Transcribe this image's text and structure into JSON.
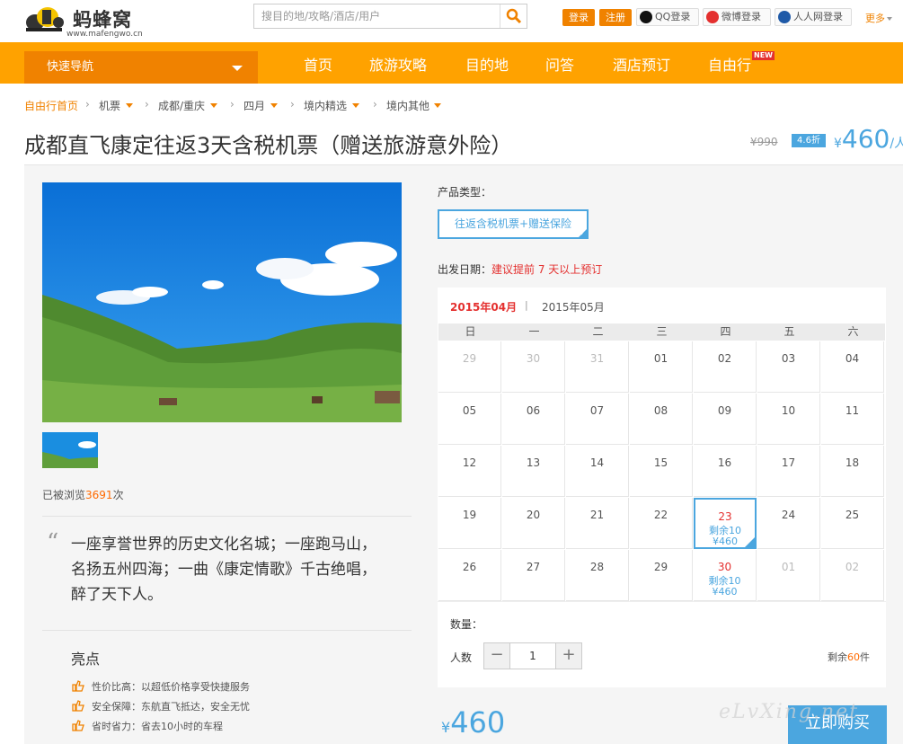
{
  "header": {
    "logo_text": "蚂蜂窝",
    "logo_url": "www.mafengwo.cn",
    "search_placeholder": "搜目的地/攻略/酒店/用户",
    "login": "登录",
    "register": "注册",
    "qq_login": "QQ登录",
    "weibo_login": "微博登录",
    "renren_login": "人人网登录",
    "more": "更多"
  },
  "nav": {
    "quick_nav": "快速导航",
    "items": [
      "首页",
      "旅游攻略",
      "目的地",
      "问答",
      "酒店预订",
      "自由行"
    ],
    "new_badge": "NEW"
  },
  "breadcrumb": [
    "自由行首页",
    "机票",
    "成都/重庆",
    "四月",
    "境内精选",
    "境内其他"
  ],
  "product": {
    "title": "成都直飞康定往返3天含税机票（赠送旅游意外险）",
    "old_price": "¥990",
    "discount": "4.6折",
    "price_symbol": "¥",
    "price": "460",
    "price_unit": "/人"
  },
  "gallery": {
    "views_prefix": "已被浏览",
    "views": "3691",
    "views_suffix": "次"
  },
  "quote": {
    "mark": "“",
    "text": "一座享誉世界的历史文化名城；一座跑马山，名扬五州四海；一曲《康定情歌》千古绝唱，醉了天下人。"
  },
  "highlights": {
    "title": "亮点",
    "items": [
      "性价比高：以超低价格享受快捷服务",
      "安全保障：东航直飞抵达，安全无忧",
      "省时省力：省去10小时的车程"
    ]
  },
  "booking": {
    "product_type_label": "产品类型：",
    "product_type": "往返含税机票+赠送保险",
    "date_label": "出发日期：",
    "date_tip": "建议提前 7 天以上预订",
    "month_active": "2015年04月",
    "month_sep": "|",
    "month_next": "2015年05月",
    "weekdays": [
      "日",
      "一",
      "二",
      "三",
      "四",
      "五",
      "六"
    ],
    "days": [
      {
        "d": "29",
        "off": true
      },
      {
        "d": "30",
        "off": true
      },
      {
        "d": "31",
        "off": true
      },
      {
        "d": "01"
      },
      {
        "d": "02"
      },
      {
        "d": "03"
      },
      {
        "d": "04"
      },
      {
        "d": "05"
      },
      {
        "d": "06"
      },
      {
        "d": "07"
      },
      {
        "d": "08"
      },
      {
        "d": "09"
      },
      {
        "d": "10"
      },
      {
        "d": "11"
      },
      {
        "d": "12"
      },
      {
        "d": "13"
      },
      {
        "d": "14"
      },
      {
        "d": "15"
      },
      {
        "d": "16"
      },
      {
        "d": "17"
      },
      {
        "d": "18"
      },
      {
        "d": "19"
      },
      {
        "d": "20"
      },
      {
        "d": "21"
      },
      {
        "d": "22"
      },
      {
        "d": "23",
        "remain": "剩余10",
        "price": "¥460",
        "selected": true
      },
      {
        "d": "24"
      },
      {
        "d": "25"
      },
      {
        "d": "26"
      },
      {
        "d": "27"
      },
      {
        "d": "28"
      },
      {
        "d": "29"
      },
      {
        "d": "30",
        "remain": "剩余10",
        "price": "¥460"
      },
      {
        "d": "01",
        "off": true
      },
      {
        "d": "02",
        "off": true
      }
    ],
    "qty_label": "数量：",
    "people_label": "人数",
    "qty_minus": "−",
    "qty_value": "1",
    "qty_plus": "+",
    "remain_prefix": "剩余",
    "remain": "60",
    "remain_suffix": "件",
    "total_symbol": "¥",
    "total": "460",
    "buy": "立即购买"
  },
  "watermark": "eLvXing.net",
  "colors": {
    "orange": "#ffa200",
    "dark_orange": "#f08200",
    "blue": "#4ba6df",
    "red": "#e4302f"
  }
}
